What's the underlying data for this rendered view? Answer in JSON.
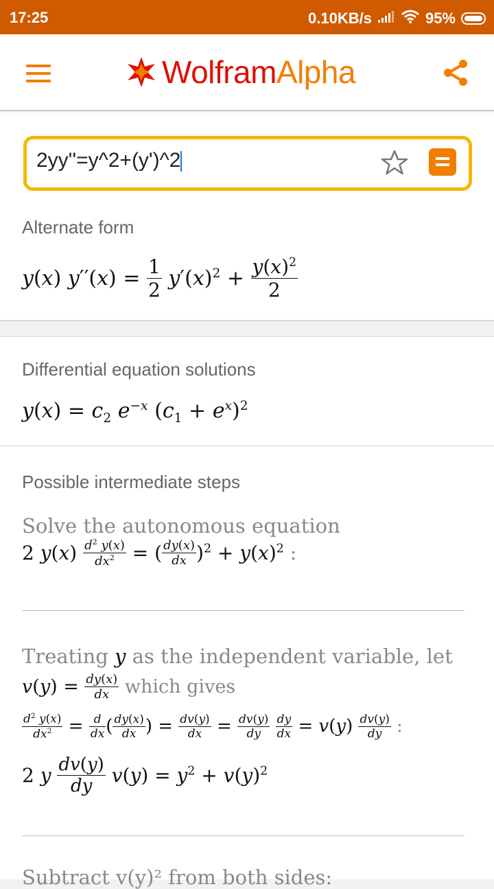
{
  "status": {
    "time": "17:25",
    "network_speed": "0.10KB/s",
    "battery": "95%"
  },
  "header": {
    "brand_left": "Wolfram",
    "brand_right": "Alpha"
  },
  "search": {
    "query": "2yy''=y^2+(y')^2"
  },
  "pods": {
    "alternate_form": {
      "title": "Alternate form"
    },
    "solutions": {
      "title": "Differential equation solutions"
    },
    "steps": {
      "title": "Possible intermediate steps",
      "step1_text": "Solve the autonomous equation",
      "step2_text_a": "Treating",
      "step2_text_var": "y",
      "step2_text_b": "as the independent variable, let",
      "step2_text_c": "which gives",
      "step3_text": "Subtract v(y)² from both sides:"
    }
  },
  "colors": {
    "status_bar": "#cf5a00",
    "accent_orange": "#f27e00",
    "brand_red": "#dd1100",
    "search_border": "#f5b800"
  }
}
